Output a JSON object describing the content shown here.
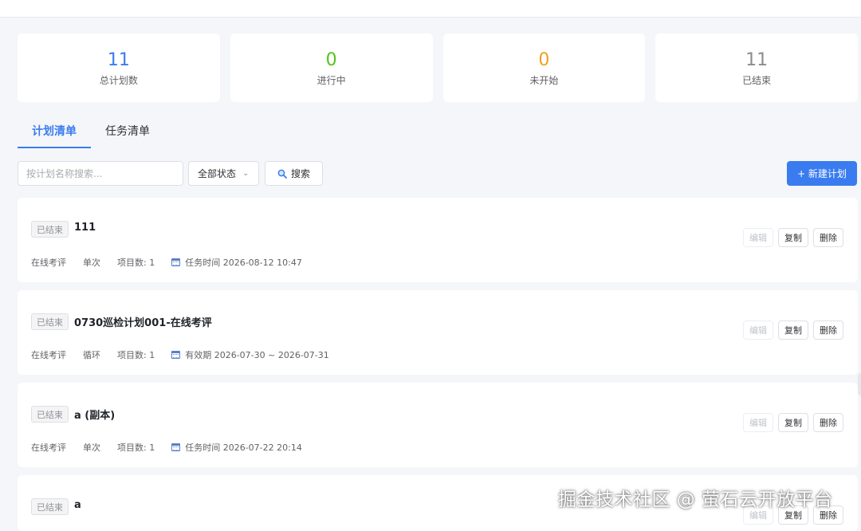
{
  "stats": [
    {
      "value": "11",
      "label": "总计划数",
      "color": "#3a7cf0"
    },
    {
      "value": "0",
      "label": "进行中",
      "color": "#52c41a"
    },
    {
      "value": "0",
      "label": "未开始",
      "color": "#f0a020"
    },
    {
      "value": "11",
      "label": "已结束",
      "color": "#8c8c8c"
    }
  ],
  "tabs": [
    {
      "label": "计划清单",
      "active": true
    },
    {
      "label": "任务清单",
      "active": false
    }
  ],
  "toolbar": {
    "search_placeholder": "按计划名称搜索...",
    "status_select_value": "全部状态",
    "search_button_label": "搜索",
    "new_plan_button_label": "+ 新建计划"
  },
  "plans": [
    {
      "status": "已结束",
      "title": "111",
      "type": "在线考评",
      "frequency": "单次",
      "items": "项目数: 1",
      "time": "任务时间 2026-08-12 10:47"
    },
    {
      "status": "已结束",
      "title": "0730巡检计划001-在线考评",
      "type": "在线考评",
      "frequency": "循环",
      "items": "项目数: 1",
      "time": "有效期 2026-07-30 ~ 2026-07-31"
    },
    {
      "status": "已结束",
      "title": "a (副本)",
      "type": "在线考评",
      "frequency": "单次",
      "items": "项目数: 1",
      "time": "任务时间 2026-07-22 20:14"
    },
    {
      "status": "已结束",
      "title": "a",
      "type": "",
      "frequency": "",
      "items": "",
      "time": ""
    }
  ],
  "actions": {
    "edit": "编辑",
    "copy": "复制",
    "delete": "删除"
  },
  "watermark": "掘金技术社区 @ 萤石云开放平台",
  "colors": {
    "primary": "#3a7cf0",
    "background": "#f4f6f9"
  }
}
